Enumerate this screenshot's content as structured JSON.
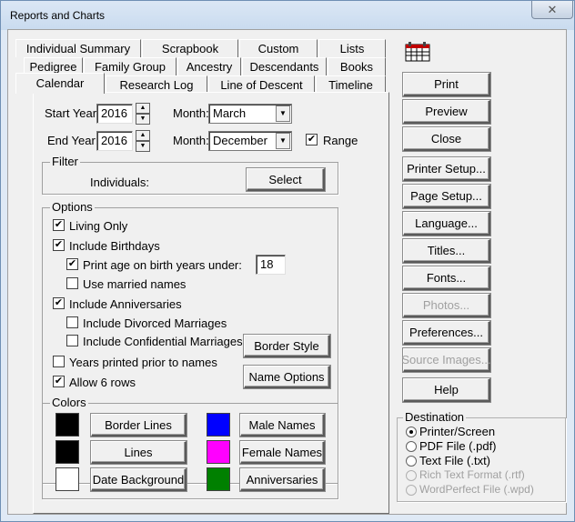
{
  "window": {
    "title": "Reports and Charts",
    "close_glyph": "✕"
  },
  "tabs": {
    "row1": [
      "Individual Summary",
      "Scrapbook",
      "Custom",
      "Lists"
    ],
    "row2": [
      "Pedigree",
      "Family Group",
      "Ancestry",
      "Descendants",
      "Books"
    ],
    "row3": [
      "Calendar",
      "Research Log",
      "Line of Descent",
      "Timeline"
    ],
    "active": "Calendar"
  },
  "calendar": {
    "start_year_label": "Start Year:",
    "start_year": "2016",
    "end_year_label": "End Year:",
    "end_year": "2016",
    "month_label_1": "Month:",
    "month_1": "March",
    "month_label_2": "Month:",
    "month_2": "December",
    "range_label": "Range",
    "range_checked": "✔"
  },
  "filter": {
    "title": "Filter",
    "individuals_label": "Individuals:",
    "select_button": "Select"
  },
  "options": {
    "title": "Options",
    "living_only": "Living Only",
    "include_birthdays": "Include Birthdays",
    "print_age": "Print age on birth years under:",
    "print_age_value": "18",
    "use_married_names": "Use married names",
    "include_anniversaries": "Include Anniversaries",
    "include_divorced": "Include Divorced Marriages",
    "include_confidential": "Include Confidential Marriages",
    "years_printed": "Years printed prior to names",
    "allow_6_rows": "Allow 6 rows",
    "border_style_button": "Border Style",
    "name_options_button": "Name Options",
    "check_glyph": "✔"
  },
  "colors": {
    "title": "Colors",
    "border_lines": "Border Lines",
    "lines": "Lines",
    "date_background": "Date Background",
    "male_names": "Male Names",
    "female_names": "Female Names",
    "anniversaries": "Anniversaries",
    "border_lines_color": "#000000",
    "lines_color": "#000000",
    "date_background_color": "#ffffff",
    "male_names_color": "#0000ff",
    "female_names_color": "#ff00ff",
    "anniversaries_color": "#008000"
  },
  "actions": {
    "print": "Print",
    "preview": "Preview",
    "close": "Close",
    "printer_setup": "Printer Setup...",
    "page_setup": "Page Setup...",
    "language": "Language...",
    "titles": "Titles...",
    "fonts": "Fonts...",
    "photos": "Photos...",
    "preferences": "Preferences...",
    "source_images": "Source Images...",
    "help": "Help"
  },
  "destination": {
    "title": "Destination",
    "options": [
      "Printer/Screen",
      "PDF File (.pdf)",
      "Text File (.txt)",
      "Rich Text Format (.rtf)",
      "WordPerfect File (.wpd)"
    ],
    "selected": "Printer/Screen"
  }
}
